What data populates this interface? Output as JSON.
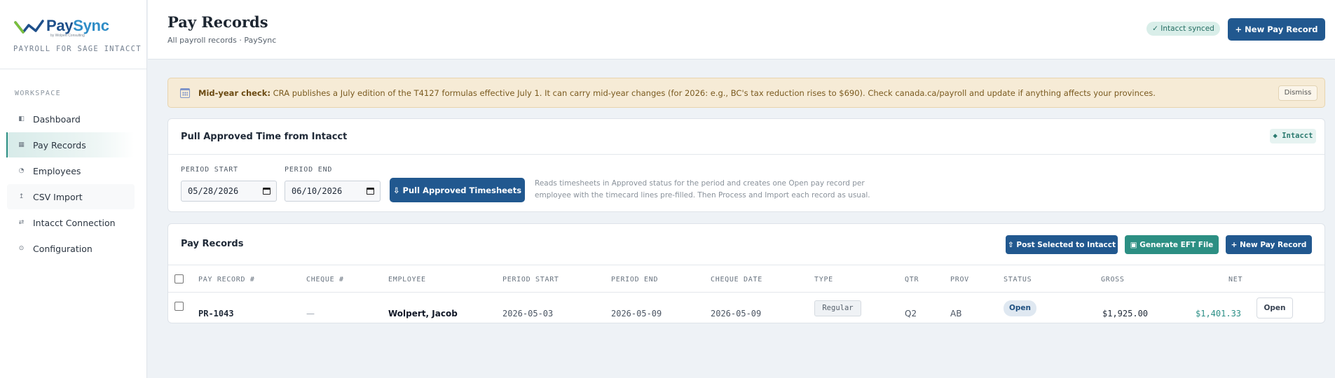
{
  "brand": {
    "name_part1": "Pay",
    "name_part2": "Sync",
    "by_line": "by Wolpert Consulting",
    "tagline": "PAYROLL FOR SAGE INTACCT"
  },
  "sidebar": {
    "section_label": "WORKSPACE",
    "active_item": "Pay Records",
    "items": [
      {
        "label": "Dashboard",
        "icon": "dashboard-icon",
        "glyph": "◧"
      },
      {
        "label": "Pay Records",
        "icon": "list-icon",
        "glyph": "▦"
      },
      {
        "label": "Employees",
        "icon": "person-icon",
        "glyph": "◔"
      },
      {
        "label": "CSV Import",
        "icon": "import-icon",
        "glyph": "↥"
      },
      {
        "label": "Intacct Connection",
        "icon": "sync-arrows-icon",
        "glyph": "⇄"
      },
      {
        "label": "Configuration",
        "icon": "gear-icon",
        "glyph": "⊙"
      }
    ]
  },
  "header": {
    "title": "Pay Records",
    "subtitle": "All payroll records · PaySync",
    "sync_status": "✓ Intacct synced",
    "new_button": "+  New Pay Record"
  },
  "banner": {
    "heading": "Mid-year check:",
    "message": "CRA publishes a July edition of the T4127 formulas effective July 1. It can carry mid-year changes (for 2026: e.g., BC's tax reduction rises to $690). Check canada.ca/payroll and update if anything affects your provinces.",
    "dismiss": "Dismiss"
  },
  "pull_card": {
    "title": "Pull Approved Time from Intacct",
    "badge": "◆ Intacct",
    "period_start_label": "PERIOD START",
    "period_start_value": "05/28/2026",
    "period_end_label": "PERIOD END",
    "period_end_value": "06/10/2026",
    "pull_button": "⇩ Pull Approved Timesheets",
    "hint": "Reads timesheets in Approved status for the period and creates one Open pay record per employee with the timecard lines pre-filled. Then Process and Import each record as usual."
  },
  "records_card": {
    "title": "Pay Records",
    "post_button": "⇧ Post Selected to Intacct",
    "eft_button": "▣ Generate EFT File",
    "new_button": "+  New Pay Record",
    "columns": [
      "PAY RECORD #",
      "CHEQUE #",
      "EMPLOYEE",
      "PERIOD START",
      "PERIOD END",
      "CHEQUE DATE",
      "TYPE",
      "QTR",
      "PROV",
      "STATUS",
      "GROSS",
      "NET"
    ],
    "rows": [
      {
        "pay_record": "PR-1043",
        "cheque": "—",
        "employee": "Wolpert, Jacob",
        "period_start": "2026-05-03",
        "period_end": "2026-05-09",
        "cheque_date": "2026-05-09",
        "type": "Regular",
        "qtr": "Q2",
        "prov": "AB",
        "status": "Open",
        "gross": "$1,925.00",
        "net": "$1,401.33",
        "action": "Open"
      }
    ]
  },
  "colors": {
    "primary": "#21588f",
    "accent_teal": "#2c8f83",
    "banner_bg": "#f6ebd6",
    "net_amount": "#2b8f86"
  }
}
